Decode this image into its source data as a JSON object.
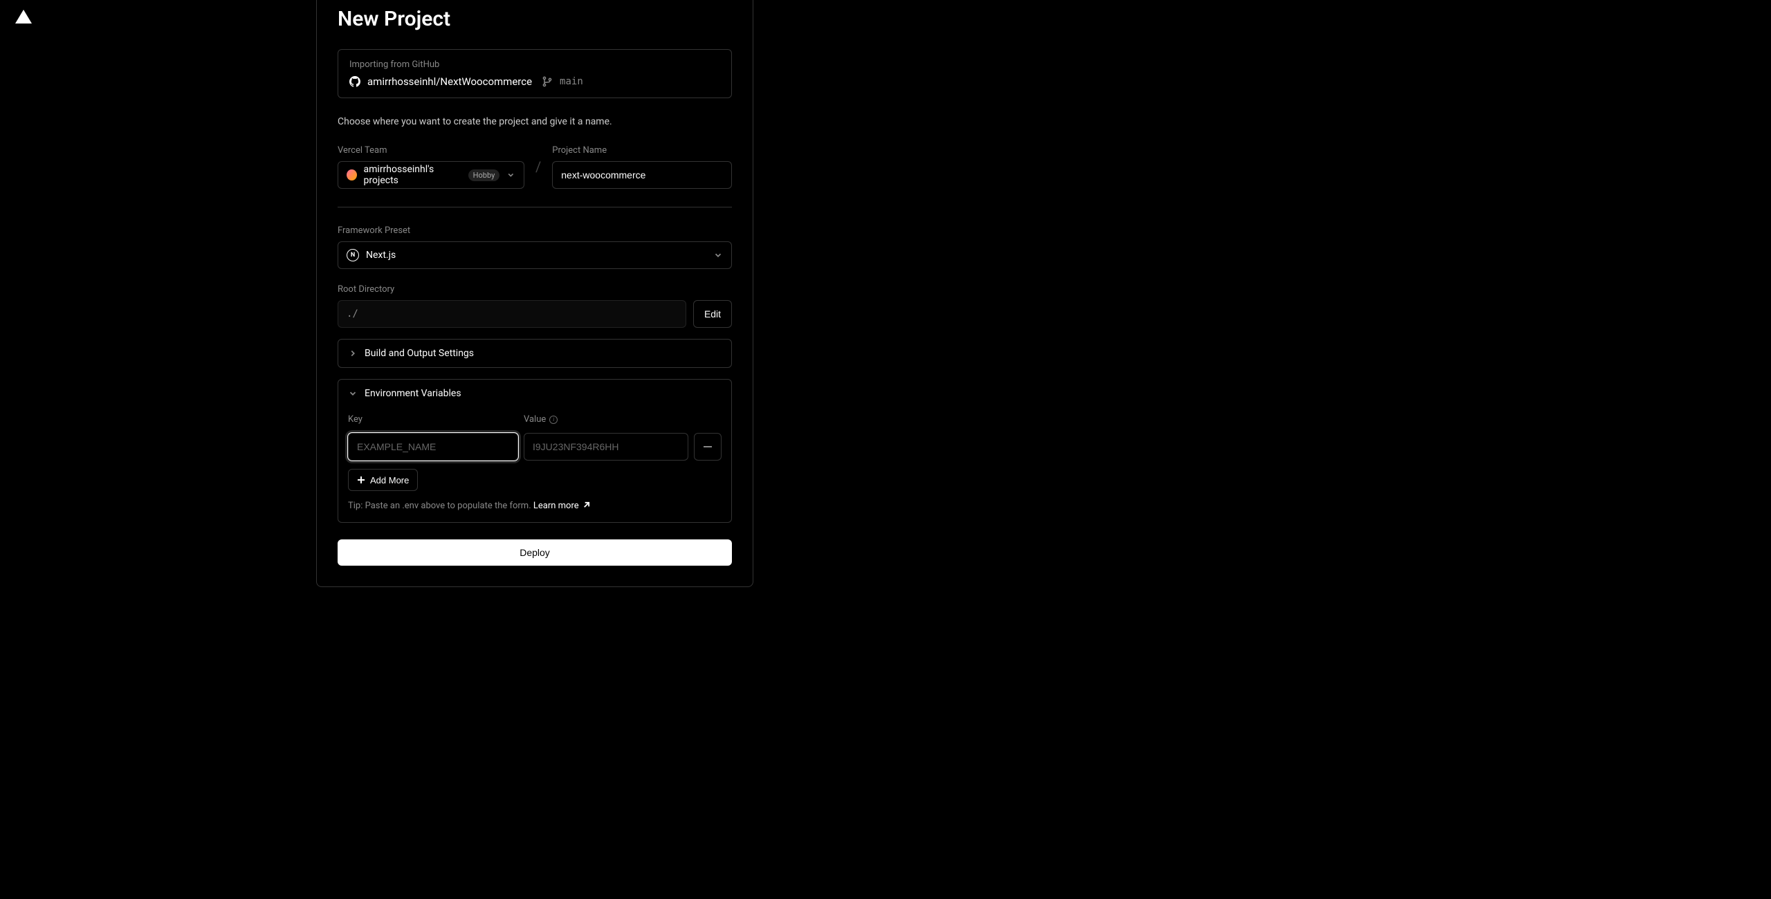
{
  "header": {
    "title": "New Project"
  },
  "import": {
    "label": "Importing from GitHub",
    "repo": "amirrhosseinhl/NextWoocommerce",
    "branch": "main"
  },
  "description": "Choose where you want to create the project and give it a name.",
  "team": {
    "label": "Vercel Team",
    "name": "amirrhosseinhl's projects",
    "badge": "Hobby"
  },
  "project_name": {
    "label": "Project Name",
    "value": "next-woocommerce"
  },
  "framework": {
    "label": "Framework Preset",
    "selected": "Next.js",
    "icon_letter": "N"
  },
  "root": {
    "label": "Root Directory",
    "value": "./",
    "edit_label": "Edit"
  },
  "build": {
    "title": "Build and Output Settings"
  },
  "env": {
    "title": "Environment Variables",
    "key_label": "Key",
    "value_label": "Value",
    "key_placeholder": "EXAMPLE_NAME",
    "value_placeholder": "I9JU23NF394R6HH",
    "add_more": "Add More",
    "tip_prefix": "Tip: Paste an .env above to populate the form. ",
    "learn_more": "Learn more"
  },
  "deploy": {
    "label": "Deploy"
  }
}
